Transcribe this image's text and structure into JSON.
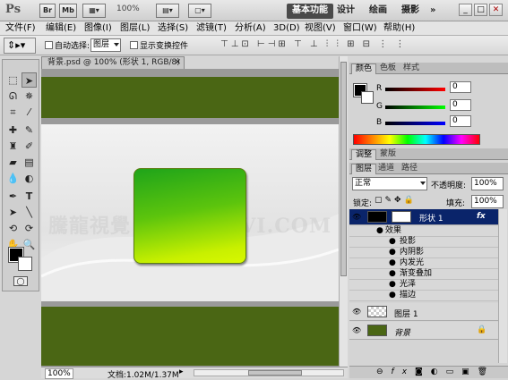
{
  "app": {
    "logo": "Ps",
    "icon_br": "Br",
    "icon_mb": "Mb",
    "zoom": "100%"
  },
  "workspaces": {
    "active": "基本功能",
    "items": [
      "设计",
      "绘画",
      "摄影"
    ],
    "more": "»"
  },
  "menu": [
    "文件(F)",
    "编辑(E)",
    "图像(I)",
    "图层(L)",
    "选择(S)",
    "滤镜(T)",
    "分析(A)",
    "3D(D)",
    "视图(V)",
    "窗口(W)",
    "帮助(H)"
  ],
  "options": {
    "auto_select": "自动选择:",
    "auto_select_value": "图层",
    "show_transform": "显示变换控件"
  },
  "document": {
    "tab_title": "背景.psd @ 100% (形状 1, RGB/8) *",
    "zoom": "100%",
    "doc_info": "文档:1.02M/1.37M",
    "watermark": "騰龍視覺 WWW.TLVI.COM"
  },
  "color_panel": {
    "tabs": [
      "颜色",
      "色板",
      "样式"
    ],
    "r_label": "R",
    "g_label": "G",
    "b_label": "B",
    "r": "0",
    "g": "0",
    "b": "0"
  },
  "adjust_tabs": [
    "调整",
    "蒙版"
  ],
  "layers_panel": {
    "tabs": [
      "图层",
      "通道",
      "路径"
    ],
    "blend_mode": "正常",
    "opacity_label": "不透明度:",
    "opacity": "100%",
    "lock_label": "锁定:",
    "fill_label": "填充:",
    "fill": "100%",
    "shape_layer": "形状 1",
    "effects_label": "效果",
    "effects": [
      "投影",
      "内阴影",
      "内发光",
      "渐变叠加",
      "光泽",
      "描边"
    ],
    "layer1": "图层 1",
    "background": "背景"
  },
  "colors": {
    "band_green": "#4a6614",
    "shape_top": "#1fa41a",
    "shape_bottom": "#d8f800",
    "selected_layer": "#0a246a"
  }
}
